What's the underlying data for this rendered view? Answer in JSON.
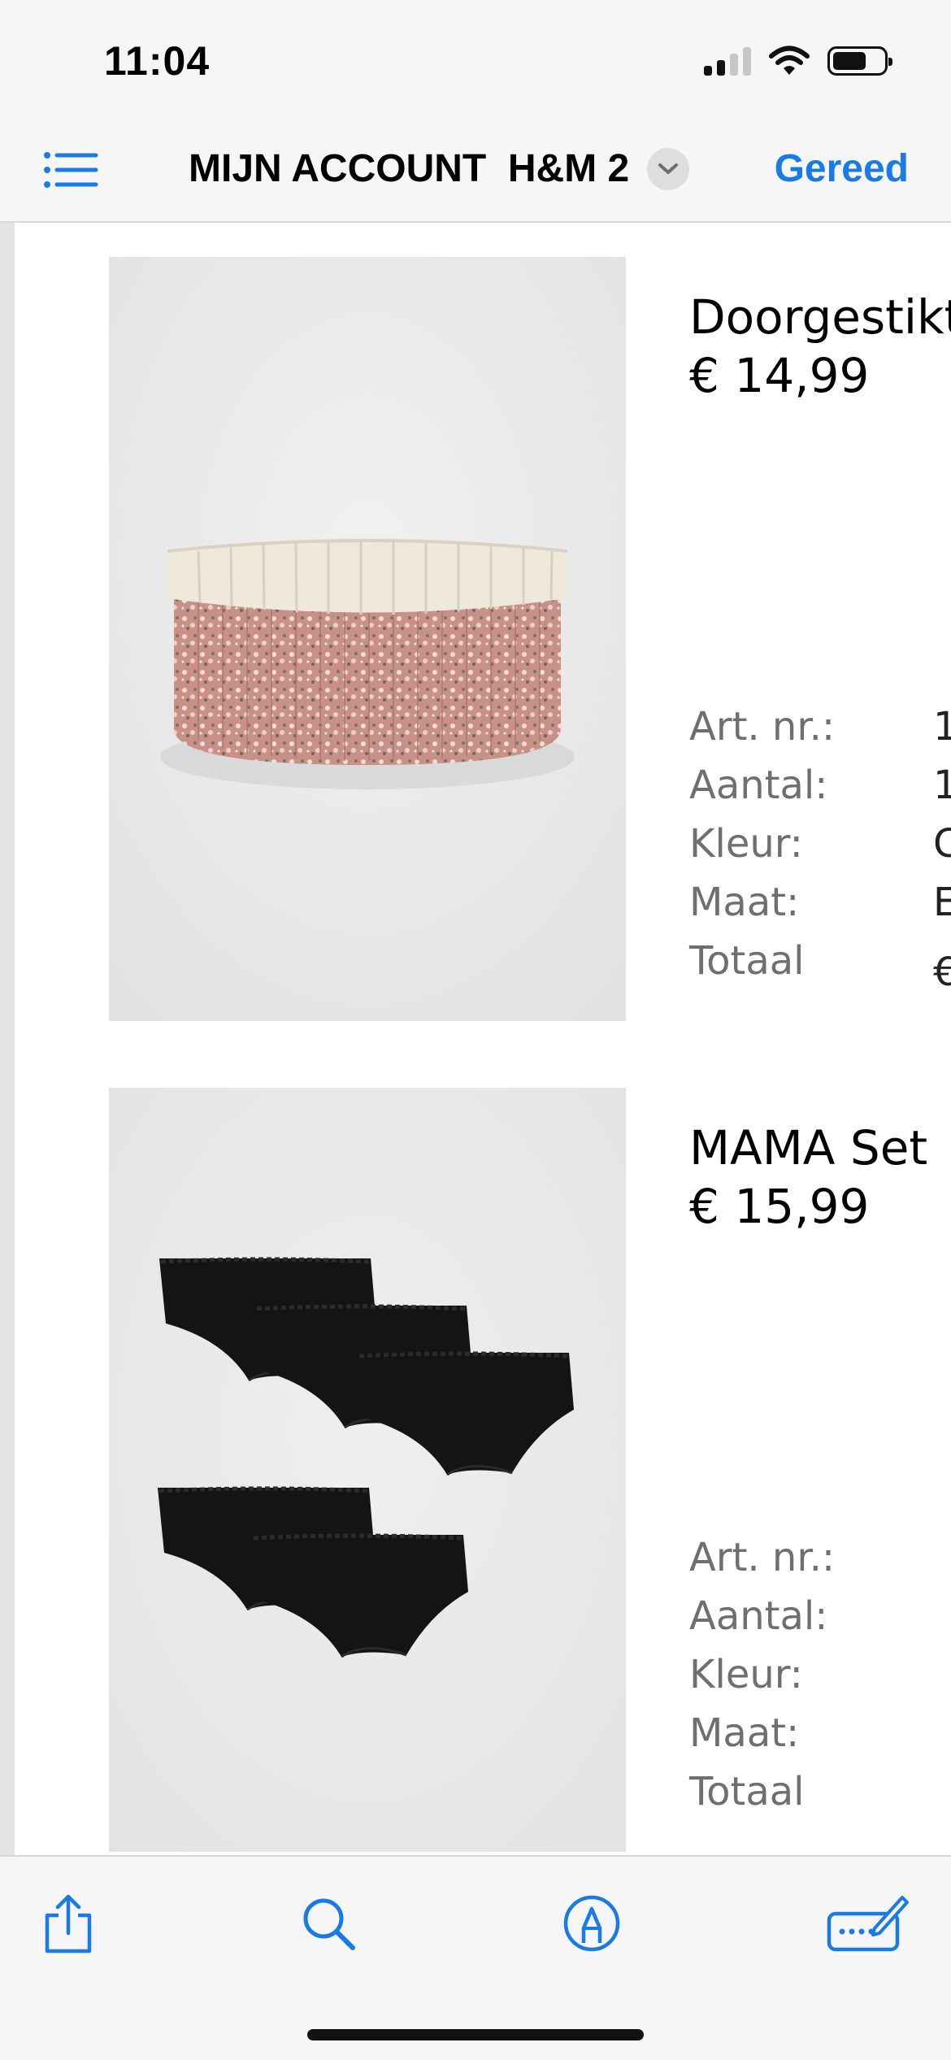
{
  "status_bar": {
    "time": "11:04",
    "icons": [
      "cellular-signal-icon",
      "wifi-icon",
      "battery-icon"
    ]
  },
  "nav": {
    "list_icon": "list-icon",
    "title": "MIJN ACCOUNT  H&M 2",
    "dropdown_icon": "chevron-down-icon",
    "done_label": "Gereed",
    "accent_color": "#1a7ae6"
  },
  "products": [
    {
      "name": "Doorgestikt",
      "price": "€ 14,99",
      "image": "flower-print-storage-basket-photo",
      "details": [
        {
          "label": "Art. nr.:",
          "value": "1"
        },
        {
          "label": "Aantal:",
          "value": "1"
        },
        {
          "label": "Kleur:",
          "value": "C"
        },
        {
          "label": "Maat:",
          "value": "E"
        },
        {
          "label": "Totaal",
          "value": "€"
        }
      ]
    },
    {
      "name": "MAMA Set",
      "price": "€ 15,99",
      "image": "black-briefs-set-photo",
      "details": [
        {
          "label": "Art. nr.:",
          "value": ""
        },
        {
          "label": "Aantal:",
          "value": ""
        },
        {
          "label": "Kleur:",
          "value": ""
        },
        {
          "label": "Maat:",
          "value": ""
        },
        {
          "label": "Totaal",
          "value": ""
        }
      ]
    }
  ],
  "toolbar": {
    "items": [
      "share-icon",
      "search-icon",
      "markup-pen-icon",
      "keyboard-edit-icon"
    ]
  }
}
